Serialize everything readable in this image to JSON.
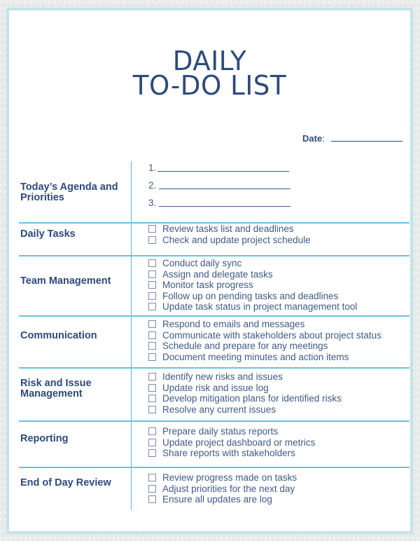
{
  "title": {
    "line1": "DAILY",
    "line2": "TO-DO LIST"
  },
  "date": {
    "label": "Date",
    "colon": ":",
    "value": ""
  },
  "colors": {
    "frame_border": "#c5e3e8",
    "accent_line": "#66c2e3",
    "text_navy": "#2d4a7a",
    "item_text": "#3f5a86"
  },
  "agenda": {
    "heading": "Today’s Agenda and Priorities",
    "items": [
      {
        "number": "1.",
        "value": ""
      },
      {
        "number": "2.",
        "value": ""
      },
      {
        "number": "3.",
        "value": ""
      }
    ]
  },
  "sections": [
    {
      "heading": "Daily Tasks",
      "items": [
        {
          "label": "Review tasks list and deadlines",
          "checked": false
        },
        {
          "label": "Check and update project schedule",
          "checked": false
        }
      ]
    },
    {
      "heading": "Team Management",
      "items": [
        {
          "label": "Conduct daily sync",
          "checked": false
        },
        {
          "label": "Assign and delegate tasks",
          "checked": false
        },
        {
          "label": "Monitor task progress",
          "checked": false
        },
        {
          "label": "Follow up on pending tasks and deadlines",
          "checked": false
        },
        {
          "label": "Update task status in project management tool",
          "checked": false
        }
      ]
    },
    {
      "heading": "Communication",
      "items": [
        {
          "label": "Respond to emails and messages",
          "checked": false
        },
        {
          "label": "Communicate with stakeholders about project status",
          "checked": false
        },
        {
          "label": "Schedule and prepare for any meetings",
          "checked": false
        },
        {
          "label": "Document meeting minutes and action items",
          "checked": false
        }
      ]
    },
    {
      "heading": "Risk and Issue Management",
      "items": [
        {
          "label": "Identify new risks and issues",
          "checked": false
        },
        {
          "label": "Update risk and issue log",
          "checked": false
        },
        {
          "label": "Develop mitigation plans for identified risks",
          "checked": false
        },
        {
          "label": "Resolve any current issues",
          "checked": false
        }
      ]
    },
    {
      "heading": "Reporting",
      "items": [
        {
          "label": "Prepare daily status reports",
          "checked": false
        },
        {
          "label": "Update project dashboard or metrics",
          "checked": false
        },
        {
          "label": "Share reports with stakeholders",
          "checked": false
        }
      ]
    },
    {
      "heading": "End of Day Review",
      "items": [
        {
          "label": "Review progress made on tasks",
          "checked": false
        },
        {
          "label": "Adjust priorities for the next day",
          "checked": false
        },
        {
          "label": "Ensure all updates are log",
          "checked": false
        }
      ]
    }
  ]
}
